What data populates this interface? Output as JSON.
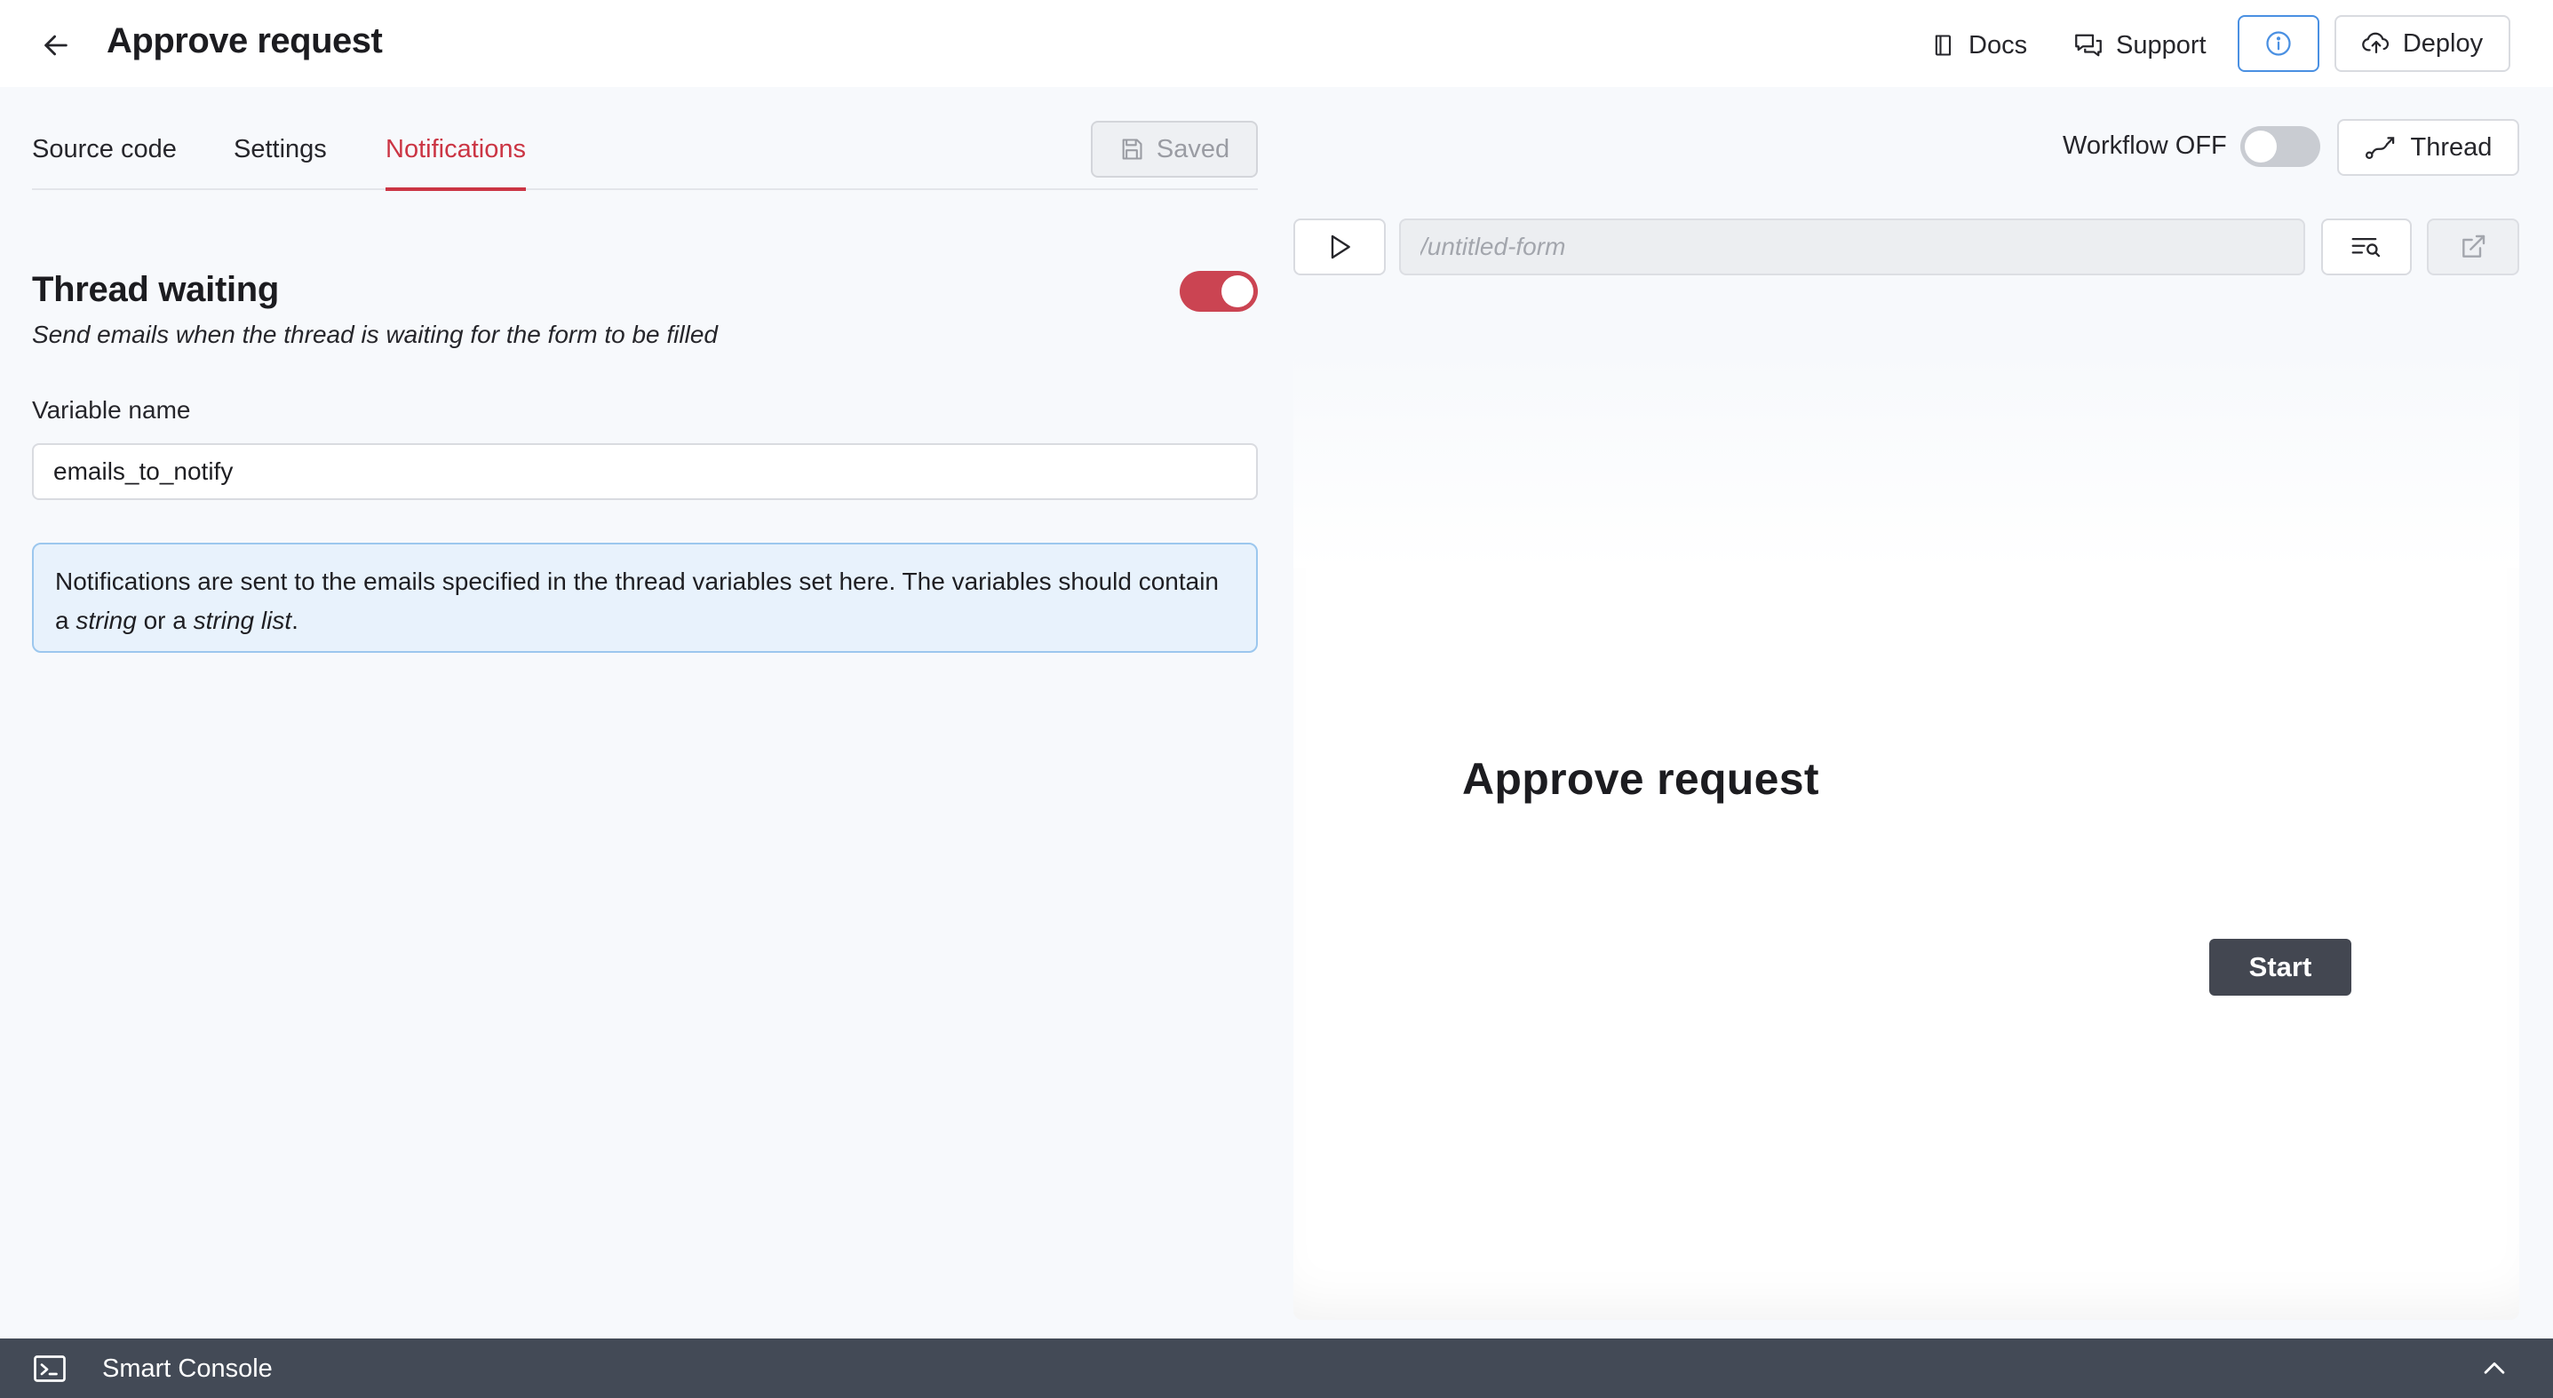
{
  "header": {
    "title": "Approve request",
    "docs_label": "Docs",
    "support_label": "Support",
    "deploy_label": "Deploy"
  },
  "editor": {
    "tabs": [
      {
        "label": "Source code"
      },
      {
        "label": "Settings"
      },
      {
        "label": "Notifications",
        "active": true
      }
    ],
    "saved_label": "Saved"
  },
  "notifications": {
    "title": "Thread waiting",
    "subtitle": "Send emails when the thread is waiting for the form to be filled",
    "enabled": true,
    "variable_label": "Variable name",
    "variable_value": "emails_to_notify",
    "info_text_1": "Notifications are sent to the emails specified in the thread variables set here. The variables should contain a ",
    "info_em_1": "string",
    "info_text_2": " or a ",
    "info_em_2": "string list",
    "info_text_3": "."
  },
  "preview_toolbar": {
    "workflow_label": "Workflow OFF",
    "workflow_enabled": false,
    "thread_label": "Thread",
    "path_placeholder": "/untitled-form"
  },
  "preview": {
    "form_title": "Approve request",
    "start_label": "Start"
  },
  "console": {
    "label": "Smart Console"
  },
  "colors": {
    "accent": "#cb3544",
    "info_border": "#4a90e2",
    "console_bg": "#434a56",
    "start_button": "#434751"
  },
  "icons": [
    "arrow-left-icon",
    "book-icon",
    "chat-icon",
    "info-icon",
    "cloud-upload-icon",
    "save-icon",
    "thread-icon",
    "play-icon",
    "list-search-icon",
    "external-link-icon",
    "terminal-icon",
    "chevron-up-icon"
  ]
}
